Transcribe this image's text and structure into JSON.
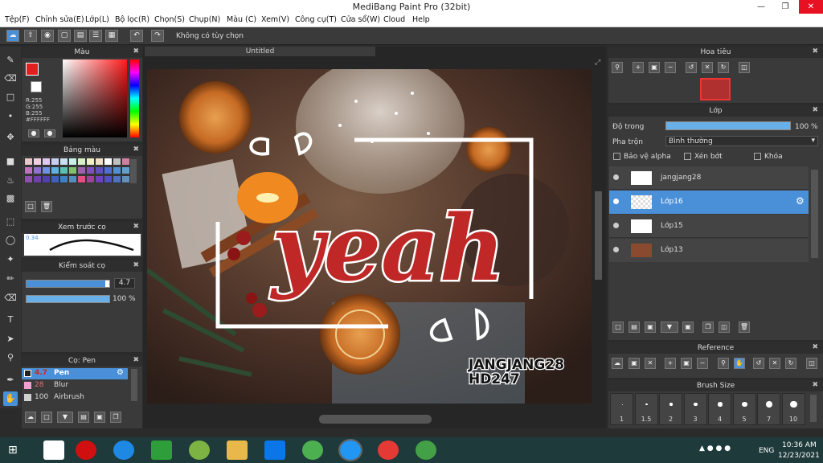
{
  "window": {
    "title": "MediBang Paint Pro (32bit)"
  },
  "menu": [
    "Tệp(F)",
    "Chỉnh sửa(E)",
    "Lớp(L)",
    "Bộ lọc(R)",
    "Chọn(S)",
    "Chụp(N)",
    "Màu (C)",
    "Xem(V)",
    "Công cụ(T)",
    "Cửa sổ(W)",
    "Cloud",
    "Help"
  ],
  "toolbar": {
    "no_selection": "Không có tùy chọn"
  },
  "color_panel": {
    "title": "Màu",
    "r": "R:255",
    "g": "G:255",
    "b": "B:255",
    "hex": "#FFFFFF",
    "primary": "#e02020",
    "secondary": "#ffffff"
  },
  "palette_panel": {
    "title": "Bảng màu",
    "swatches": [
      "#e8c8c8",
      "#f0d0e0",
      "#e0c8f0",
      "#c8d0f0",
      "#c8e0f0",
      "#c8f0e8",
      "#d8f0c8",
      "#f0f0c8",
      "#f0e0c8",
      "#ffffff",
      "#c0c0c0",
      "#d080a0",
      "#c070c0",
      "#9070d0",
      "#7090e0",
      "#60b0e0",
      "#60c0b0",
      "#80c070",
      "#a060b0",
      "#8050c0",
      "#6050c0",
      "#5070d0",
      "#5090d0",
      "#60a0d0",
      "#9050b0",
      "#7040b0",
      "#5040b0",
      "#4060c0",
      "#4080c0",
      "#5090c0",
      "#e05080",
      "#a040a0",
      "#7040c0",
      "#5050c0",
      "#5070c0",
      "#6090c0"
    ]
  },
  "brush_preview": {
    "title": "Xem trước cọ",
    "size_label": "0.34"
  },
  "brush_control": {
    "title": "Kiểm soát cọ",
    "size_value": "4.7",
    "opacity_value": "100 %",
    "opacity_fraction": 1.0,
    "size_fraction": 0.95
  },
  "brush_list": {
    "title": "Cọ: Pen",
    "items": [
      {
        "size": "4.7",
        "name": "Pen",
        "active": true,
        "color": "#e02020"
      },
      {
        "size": "28",
        "name": "Blur",
        "active": false,
        "color": "#f0a0d0"
      },
      {
        "size": "100",
        "name": "Airbrush",
        "active": false,
        "color": "#d0d0d0"
      }
    ]
  },
  "canvas": {
    "tab": "Untitled",
    "title_art": "yeah",
    "watermark_line1": "JANGJANG28",
    "watermark_line2": "HD247"
  },
  "navigator": {
    "title": "Hoa tiêu"
  },
  "layer_panel": {
    "title": "Lớp",
    "opacity_label": "Độ trong",
    "opacity_value": "100 %",
    "opacity_fraction": 1.0,
    "blend_label": "Pha trộn",
    "blend_value": "Bình thường",
    "protect_alpha": "Bảo vệ alpha",
    "clipping": "Xén bớt",
    "lock": "Khóa",
    "layers": [
      {
        "name": "jangjang28",
        "selected": false
      },
      {
        "name": "Lớp16",
        "selected": true
      },
      {
        "name": "Lớp15",
        "selected": false
      },
      {
        "name": "Lớp13",
        "selected": false
      }
    ]
  },
  "reference_panel": {
    "title": "Reference"
  },
  "brush_size_panel": {
    "title": "Brush Size",
    "sizes": [
      "1",
      "1.5",
      "2",
      "3",
      "4",
      "5",
      "7",
      "10"
    ]
  },
  "taskbar": {
    "time": "10:36 AM",
    "date": "12/23/2021",
    "lang": "ENG"
  }
}
